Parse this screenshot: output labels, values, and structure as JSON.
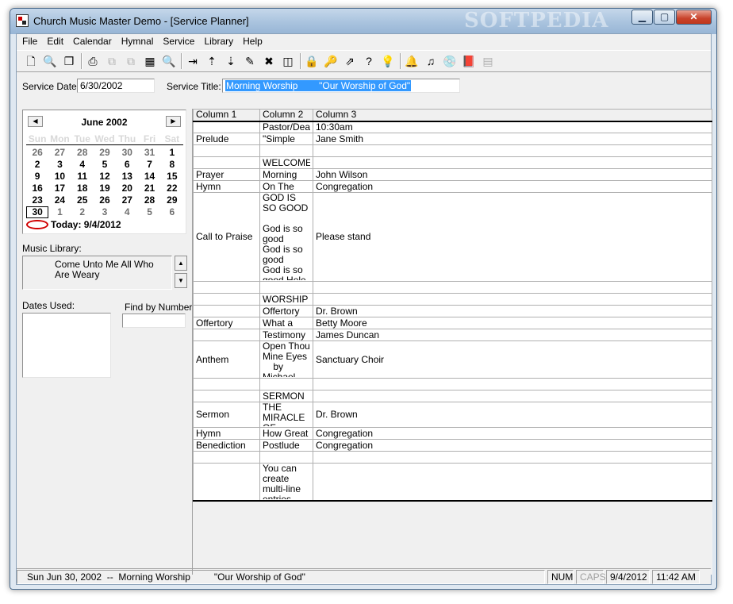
{
  "window": {
    "title": "Church Music Master Demo - [Service Planner]",
    "watermark": "SOFTPEDIA",
    "min_glyph": "▁",
    "max_glyph": "▢",
    "close_glyph": "✕"
  },
  "menu": [
    "File",
    "Edit",
    "Calendar",
    "Hymnal",
    "Service",
    "Library",
    "Help"
  ],
  "toolbar": {
    "icons": [
      {
        "name": "new-service-icon",
        "glyph": "🗋"
      },
      {
        "name": "find-icon",
        "glyph": "🔍"
      },
      {
        "name": "copy-icon",
        "glyph": "❐"
      },
      {
        "name": "print-icon",
        "glyph": "⎙"
      },
      {
        "name": "copy-row-icon",
        "glyph": "⧉"
      },
      {
        "name": "paste-row-icon",
        "glyph": "⧉"
      },
      {
        "name": "calendar-icon",
        "glyph": "▦"
      },
      {
        "name": "preview-icon",
        "glyph": "🔍"
      },
      {
        "name": "insert-row-icon",
        "glyph": "⇥"
      },
      {
        "name": "move-up-icon",
        "glyph": "⇡"
      },
      {
        "name": "move-down-icon",
        "glyph": "⇣"
      },
      {
        "name": "edit-row-icon",
        "glyph": "✎"
      },
      {
        "name": "delete-row-icon",
        "glyph": "✖"
      },
      {
        "name": "view-icon",
        "glyph": "◫"
      },
      {
        "name": "lock-icon",
        "glyph": "🔒"
      },
      {
        "name": "key-icon",
        "glyph": "🔑"
      },
      {
        "name": "export-icon",
        "glyph": "⇗"
      },
      {
        "name": "help-icon",
        "glyph": "?"
      },
      {
        "name": "tip-icon",
        "glyph": "💡"
      },
      {
        "name": "bell-icon",
        "glyph": "🔔"
      },
      {
        "name": "music-note-icon",
        "glyph": "♫"
      },
      {
        "name": "cd-icon",
        "glyph": "💿"
      },
      {
        "name": "book-icon",
        "glyph": "📕"
      },
      {
        "name": "calculator-icon",
        "glyph": "▤"
      }
    ]
  },
  "service": {
    "date_label": "Service Date:",
    "date_value": "6/30/2002",
    "title_label": "Service Title:",
    "title_value": "Morning Worship        \"Our Worship of God\""
  },
  "calendar": {
    "prev": "◀",
    "next": "▶",
    "month": "June 2002",
    "dow": [
      "Sun",
      "Mon",
      "Tue",
      "Wed",
      "Thu",
      "Fri",
      "Sat"
    ],
    "weeks": [
      [
        "26",
        "27",
        "28",
        "29",
        "30",
        "31",
        "1"
      ],
      [
        "2",
        "3",
        "4",
        "5",
        "6",
        "7",
        "8"
      ],
      [
        "9",
        "10",
        "11",
        "12",
        "13",
        "14",
        "15"
      ],
      [
        "16",
        "17",
        "18",
        "19",
        "20",
        "21",
        "22"
      ],
      [
        "23",
        "24",
        "25",
        "26",
        "27",
        "28",
        "29"
      ],
      [
        "30",
        "1",
        "2",
        "3",
        "4",
        "5",
        "6"
      ]
    ],
    "today": "Today: 9/4/2012"
  },
  "library": {
    "label": "Music Library:",
    "item": "Come Unto Me All Who Are Weary",
    "up": "▲",
    "down": "▼"
  },
  "dates_used_label": "Dates Used:",
  "find_by_number_label": "Find by Number:",
  "grid": {
    "headers": [
      "Column 1",
      "Column 2",
      "Column 3"
    ],
    "rows": [
      [
        "",
        "Pastor/Deac",
        "10:30am"
      ],
      [
        "Prelude",
        "\"Simple",
        "Jane Smith"
      ],
      [
        "",
        "",
        ""
      ],
      [
        "",
        "WELCOME",
        ""
      ],
      [
        "Prayer",
        "Morning",
        "John Wilson"
      ],
      [
        "Hymn",
        "On The",
        "Congregation"
      ],
      [
        "Call to Praise",
        "GOD IS SO GOOD\n\nGod is so good\nGod is so good\nGod is so good Hele",
        "Please stand"
      ],
      [
        "",
        "",
        ""
      ],
      [
        "",
        "WORSHIP",
        ""
      ],
      [
        "",
        "Offertory",
        "Dr. Brown"
      ],
      [
        "Offertory",
        "What a",
        "Betty Moore"
      ],
      [
        "",
        "Testimony",
        "James Duncan"
      ],
      [
        "Anthem",
        "Open Thou Mine Eyes\n    by\nMichael Cox",
        "Sanctuary Choir"
      ],
      [
        "",
        "",
        ""
      ],
      [
        "",
        "SERMON",
        ""
      ],
      [
        "Sermon",
        "THE MIRACLE OF",
        "Dr. Brown"
      ],
      [
        "Hymn",
        "How Great",
        "Congregation"
      ],
      [
        "Benediction",
        "Postlude",
        "Congregation"
      ],
      [
        "",
        "",
        ""
      ],
      [
        "",
        "You can create multi-line entries",
        ""
      ]
    ]
  },
  "status": {
    "service": "Sun Jun 30, 2002  --  Morning Worship         \"Our Worship of God\"",
    "num": "NUM",
    "caps": "CAPS",
    "date": "9/4/2012",
    "time": "11:42 AM"
  }
}
